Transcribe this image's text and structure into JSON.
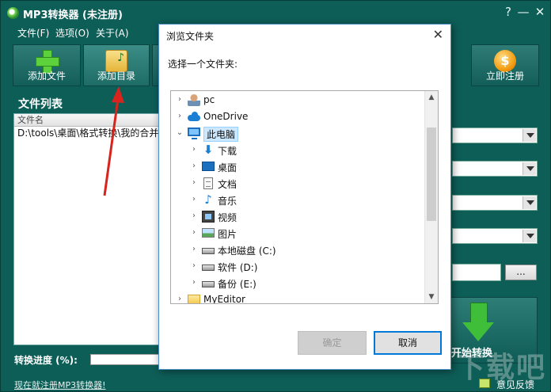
{
  "app": {
    "title": "MP3转换器 (未注册)",
    "controls": {
      "help": "?",
      "minimize": "—",
      "close": "✕"
    }
  },
  "menu": [
    "文件(F)",
    "选项(O)",
    "关于(A)"
  ],
  "toolbar": {
    "add_file": "添加文件",
    "add_dir": "添加目录",
    "register": "立即注册"
  },
  "file_list": {
    "section_title": "文件列表",
    "column_header": "文件名",
    "rows": [
      "D:\\tools\\桌面\\格式转换\\我的合并"
    ]
  },
  "right_panel": {
    "browse_label": "..."
  },
  "convert": {
    "label": "开始转换"
  },
  "progress": {
    "label": "转换进度 (%):",
    "value": 0
  },
  "register_link": "现在就注册MP3转换器!",
  "feedback": "意见反馈",
  "watermark": "下载吧",
  "dialog": {
    "title": "浏览文件夹",
    "prompt": "选择一个文件夹:",
    "close": "✕",
    "tree": [
      {
        "label": "pc",
        "icon": "person-icon",
        "level": 0,
        "expanded": false,
        "selected": false
      },
      {
        "label": "OneDrive",
        "icon": "cloud-icon",
        "level": 0,
        "expanded": false,
        "selected": false
      },
      {
        "label": "此电脑",
        "icon": "monitor-icon",
        "level": 0,
        "expanded": true,
        "selected": true
      },
      {
        "label": "下载",
        "icon": "download-icon",
        "level": 1,
        "expanded": false,
        "selected": false
      },
      {
        "label": "桌面",
        "icon": "desktop-icon",
        "level": 1,
        "expanded": false,
        "selected": false
      },
      {
        "label": "文档",
        "icon": "document-icon",
        "level": 1,
        "expanded": false,
        "selected": false
      },
      {
        "label": "音乐",
        "icon": "music-icon",
        "level": 1,
        "expanded": false,
        "selected": false
      },
      {
        "label": "视频",
        "icon": "video-icon",
        "level": 1,
        "expanded": false,
        "selected": false
      },
      {
        "label": "图片",
        "icon": "picture-icon",
        "level": 1,
        "expanded": false,
        "selected": false
      },
      {
        "label": "本地磁盘 (C:)",
        "icon": "drive-icon",
        "level": 1,
        "expanded": false,
        "selected": false
      },
      {
        "label": "软件 (D:)",
        "icon": "drive-icon",
        "level": 1,
        "expanded": false,
        "selected": false
      },
      {
        "label": "备份 (E:)",
        "icon": "drive-icon",
        "level": 1,
        "expanded": false,
        "selected": false
      },
      {
        "label": "MyEditor",
        "icon": "folder-icon",
        "level": 0,
        "expanded": false,
        "selected": false
      }
    ],
    "ok": "确定",
    "cancel": "取消"
  }
}
